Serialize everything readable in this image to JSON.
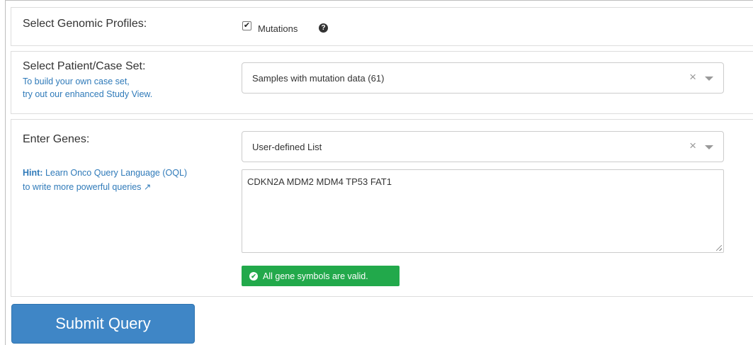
{
  "genomic_profiles": {
    "title": "Select Genomic Profiles:",
    "mutations_checkbox": {
      "checked": true,
      "glyph": "✔",
      "label": "Mutations"
    },
    "help_icon": "?"
  },
  "case_set": {
    "title": "Select Patient/Case Set:",
    "link_line1": "To build your own case set,",
    "link_line2": "try out our enhanced Study View.",
    "selected": "Samples with mutation data (61)",
    "clear_glyph": "×"
  },
  "genes": {
    "title": "Enter Genes:",
    "hint_bold": "Hint:",
    "hint_line1": " Learn Onco Query Language (OQL)",
    "hint_line2": "to write more powerful queries",
    "external_link_glyph": "↗",
    "list_selected": "User-defined List",
    "clear_glyph": "×",
    "textarea_value": "CDKN2A MDM2 MDM4 TP53 FAT1",
    "validation_message": "All gene symbols are valid.",
    "validation_glyph": "✔"
  },
  "submit": {
    "label": "Submit Query"
  },
  "colors": {
    "link": "#2f7ab9",
    "valid_green": "#22a94b",
    "submit_blue": "#3f86c6"
  }
}
